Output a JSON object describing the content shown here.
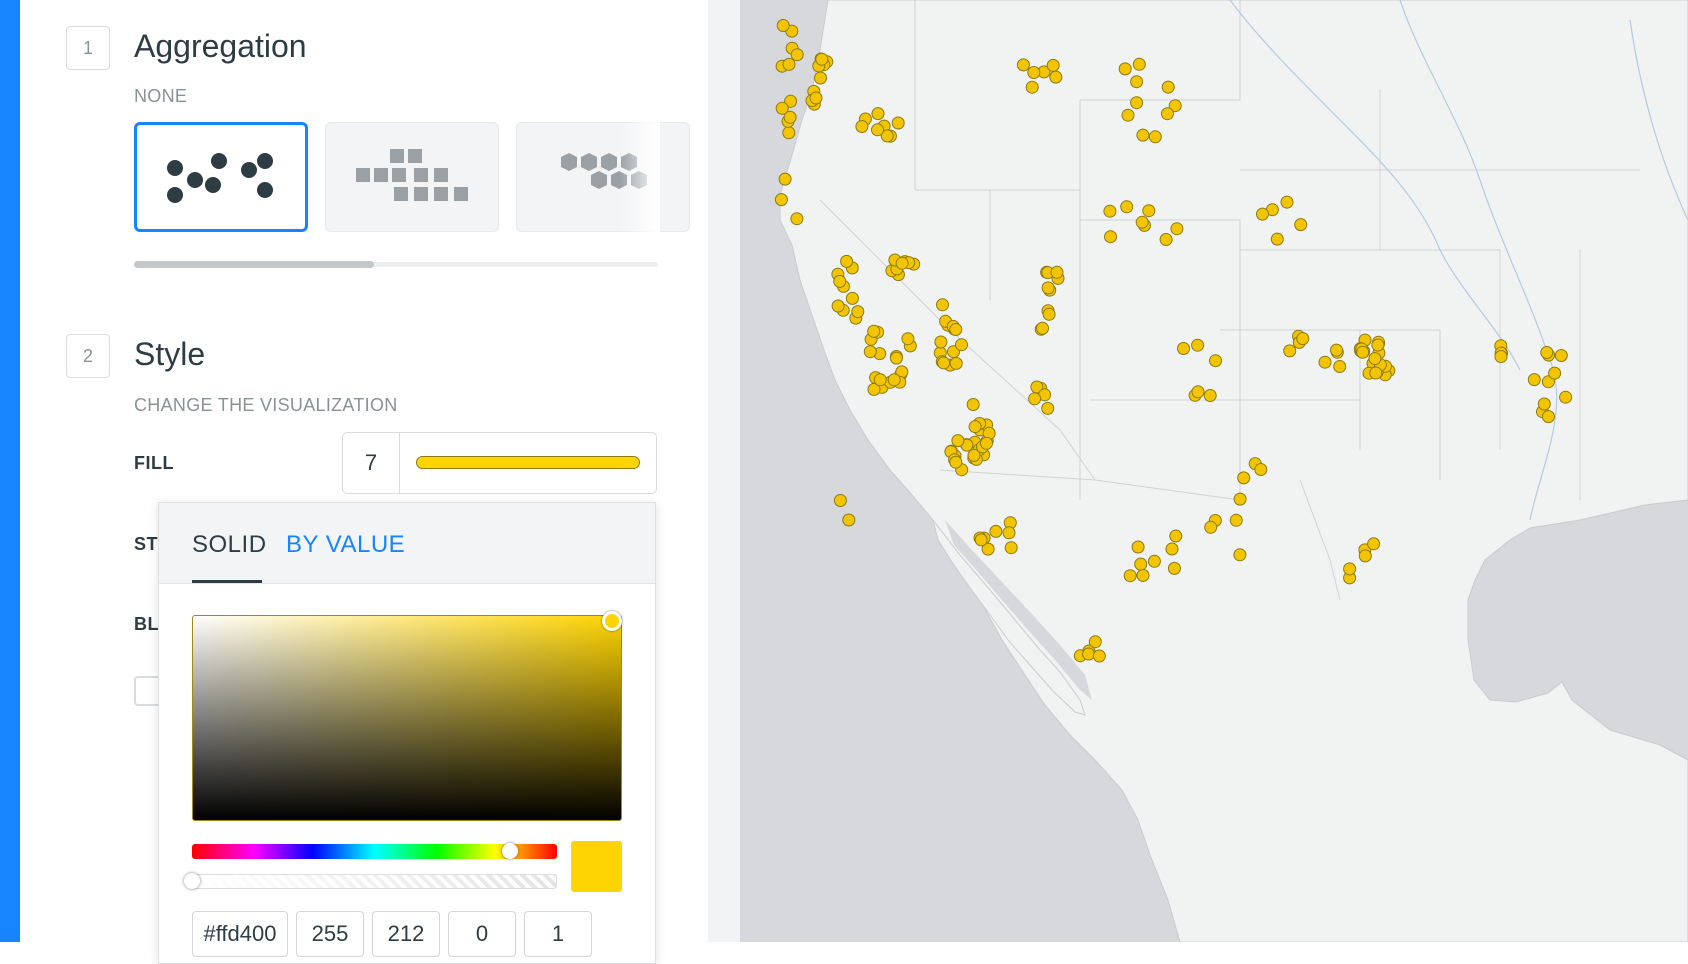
{
  "panel": {
    "aggregation": {
      "step": "1",
      "title": "Aggregation",
      "subtitle": "NONE",
      "options": [
        {
          "icon": "points-icon",
          "selected": true
        },
        {
          "icon": "squares-grid-icon",
          "selected": false
        },
        {
          "icon": "hexbins-icon",
          "selected": false
        }
      ]
    },
    "style": {
      "step": "2",
      "title": "Style",
      "subtitle": "CHANGE THE VISUALIZATION",
      "fill_label": "FILL",
      "fill_size": "7",
      "fill_color": "#ffd400",
      "stroke_label_partial": "ST",
      "blending_label_partial": "BL"
    }
  },
  "color_picker": {
    "tabs": [
      {
        "label": "SOLID",
        "active": true
      },
      {
        "label": "BY VALUE",
        "active": false
      }
    ],
    "hex": "#ffd400",
    "r": "255",
    "g": "212",
    "b": "0",
    "a": "1",
    "selected_color": "#ffd400"
  },
  "colors": {
    "accent": "#1785fb",
    "point": "#f3c500",
    "point_stroke": "#8a7a12",
    "land": "#f1f2f2",
    "water": "#d6d8db"
  },
  "map": {
    "visible": true
  }
}
